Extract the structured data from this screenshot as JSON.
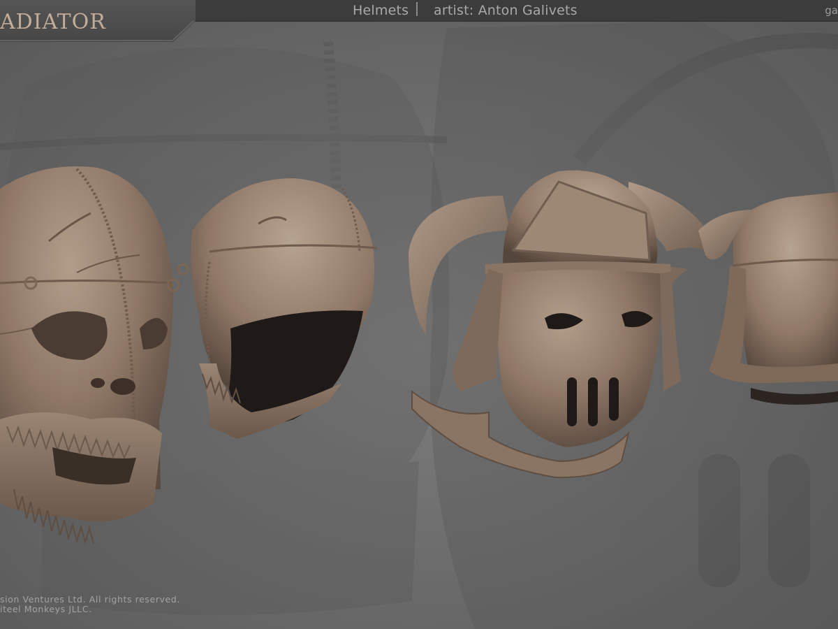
{
  "header": {
    "section": "Helmets",
    "separator": "|",
    "artist": "artist: Anton Galivets",
    "corner": "ga"
  },
  "title": "ADIATOR",
  "footer": {
    "line1": "sion Ventures Ltd. All rights reserved.",
    "line2": "iteel Monkeys JLLC."
  },
  "colors": {
    "helmet": "#8e7766",
    "background": "#6f6f6f",
    "title": "#c2ad99"
  }
}
